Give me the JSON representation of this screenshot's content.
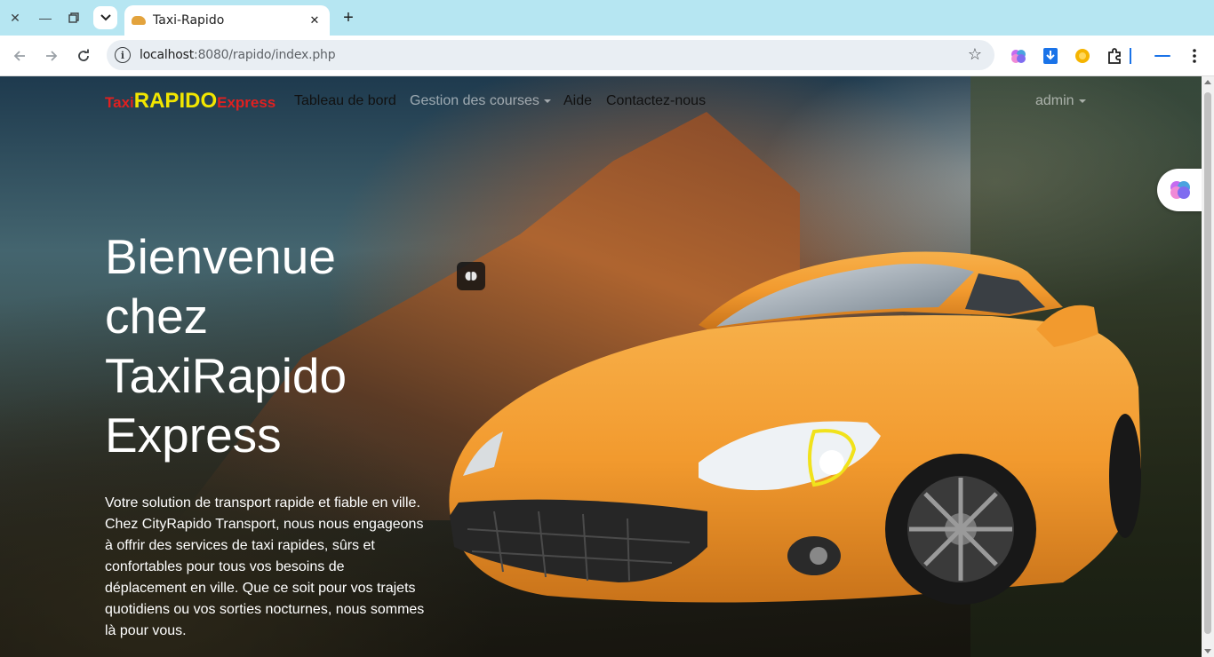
{
  "browser": {
    "tab_title": "Taxi-Rapido",
    "url_host": "localhost",
    "url_rest": ":8080/rapido/index.php"
  },
  "navbar": {
    "brand_taxi": "Taxi",
    "brand_rapido": "RAPIDO",
    "brand_express": "Express",
    "links": {
      "dashboard": "Tableau de bord",
      "courses": "Gestion des courses",
      "help": "Aide",
      "contact": "Contactez-nous"
    },
    "user": "admin"
  },
  "hero": {
    "title": "Bienvenue chez TaxiRapido Express",
    "text": "Votre solution de transport rapide et fiable en ville. Chez CityRapido Transport, nous nous engageons à offrir des services de taxi rapides, sûrs et confortables pour tous vos besoins de déplacement en ville. Que ce soit pour vos trajets quotidiens ou vos sorties nocturnes, nous sommes là pour vous."
  },
  "colors": {
    "brand_red": "#e02020",
    "brand_yellow": "#f2e600",
    "car_orange": "#f29a2e"
  }
}
